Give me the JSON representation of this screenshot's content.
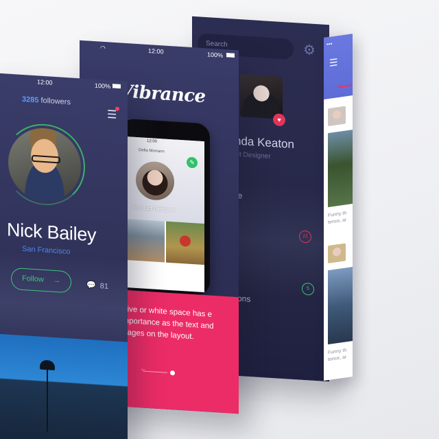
{
  "back_screen": {
    "search_placeholder": "Search",
    "gear_icon": "gear-icon",
    "name_partial": "nda Keaton",
    "role_partial": "ct Designer",
    "menu_partial": [
      "de",
      "g",
      "tions"
    ],
    "badge_red": "22",
    "badge_green": "5"
  },
  "side_list": {
    "snippet_1": "Funny th tence, ar",
    "snippet_2": "Funny th tence, ar"
  },
  "middle_screen": {
    "time": "12:00",
    "battery": "100%",
    "brand": "Vibrance",
    "phone": {
      "time": "12:00",
      "name": "Delia Morrann",
      "role": "Product Designer"
    },
    "pink_text": "ative or white space has e importance as the text and mages on the layout."
  },
  "front_screen": {
    "time": "12:00",
    "battery": "100%",
    "followers_count": "3285",
    "followers_label": "followers",
    "name": "Nick Bailey",
    "location": "San Francisco",
    "follow_label": "Follow",
    "follow_arrow": "→",
    "comment_count": "81"
  },
  "colors": {
    "pink": "#ec2c66",
    "green": "#3fc778",
    "blue": "#4d87e8",
    "navy": "#2e3057",
    "side_header": "#6a78e0"
  }
}
